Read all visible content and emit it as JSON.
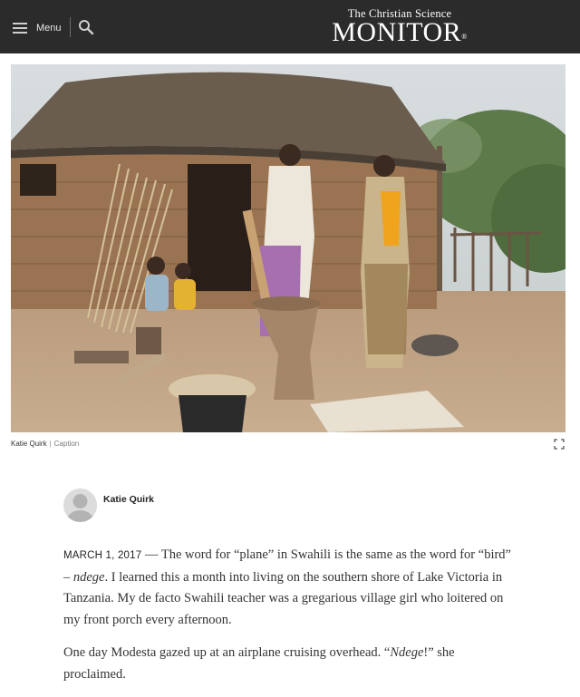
{
  "header": {
    "menu_label": "Menu",
    "logo_top": "The Christian Science",
    "logo_main": "MONITOR",
    "logo_mark": "®"
  },
  "photo": {
    "credit": "Katie Quirk",
    "separator": "|",
    "caption_link": "Caption"
  },
  "byline": {
    "author": "Katie Quirk"
  },
  "article": {
    "dateline": "MARCH 1, 2017",
    "dash": " — ",
    "p1_a": "The word for “plane” in Swahili is the same as the word for “bird” – ",
    "p1_em": "ndege",
    "p1_b": ". I learned this a month into living on the southern shore of Lake Victoria in Tanzania. My de facto Swahili teacher was a gregarious village girl who loitered on my front porch every afternoon.",
    "p2_a": "One day Modesta gazed up at an airplane cruising overhead. “",
    "p2_em": "Ndege",
    "p2_b": "!” she proclaimed."
  },
  "colors": {
    "topbar": "#2b2b2b",
    "text": "#333333"
  },
  "icons": [
    "hamburger-icon",
    "search-icon",
    "expand-icon",
    "avatar-placeholder"
  ]
}
